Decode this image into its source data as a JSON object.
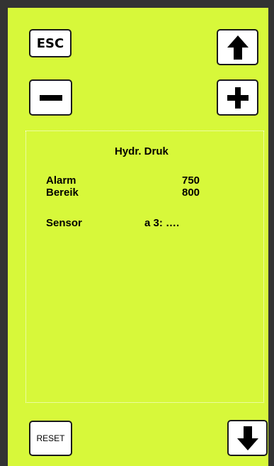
{
  "buttons": {
    "esc_label": "ESC",
    "reset_label": "RESET",
    "up_icon": "arrow-up-icon",
    "down_icon": "arrow-down-icon",
    "minus_icon": "minus-icon",
    "plus_icon": "plus-icon"
  },
  "panel": {
    "title": "Hydr. Druk",
    "rows": [
      {
        "label": "Alarm",
        "value": "750"
      },
      {
        "label": "Bereik",
        "value": "800"
      }
    ],
    "sensor": {
      "label": "Sensor",
      "value": "a 3:  …."
    }
  },
  "colors": {
    "background": "#d7f83a",
    "frame": "#333333",
    "button": "#ffffff"
  }
}
